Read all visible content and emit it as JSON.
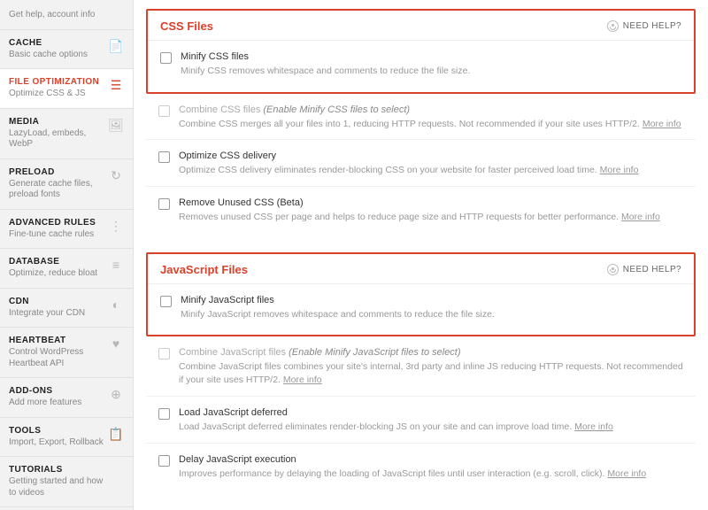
{
  "sidebar": [
    {
      "title": "",
      "sub": "Get help, account info",
      "icon": ""
    },
    {
      "title": "CACHE",
      "sub": "Basic cache options",
      "icon": "📄"
    },
    {
      "title": "FILE OPTIMIZATION",
      "sub": "Optimize CSS & JS",
      "icon": "☰",
      "active": true
    },
    {
      "title": "MEDIA",
      "sub": "LazyLoad, embeds, WebP",
      "icon": "🖼"
    },
    {
      "title": "PRELOAD",
      "sub": "Generate cache files, preload fonts",
      "icon": "↻"
    },
    {
      "title": "ADVANCED RULES",
      "sub": "Fine-tune cache rules",
      "icon": "⋮"
    },
    {
      "title": "DATABASE",
      "sub": "Optimize, reduce bloat",
      "icon": "≡"
    },
    {
      "title": "CDN",
      "sub": "Integrate your CDN",
      "icon": "◐"
    },
    {
      "title": "HEARTBEAT",
      "sub": "Control WordPress Heartbeat API",
      "icon": "♥"
    },
    {
      "title": "ADD-ONS",
      "sub": "Add more features",
      "icon": "⊕"
    },
    {
      "title": "TOOLS",
      "sub": "Import, Export, Rollback",
      "icon": "📋"
    },
    {
      "title": "TUTORIALS",
      "sub": "Getting started and how to videos",
      "icon": ""
    }
  ],
  "help": "NEED HELP?",
  "more": "More info",
  "sections": {
    "css": {
      "title": "CSS Files",
      "options": [
        {
          "title": "Minify CSS files",
          "desc": "Minify CSS removes whitespace and comments to reduce the file size.",
          "boxed": true
        },
        {
          "title": "Combine CSS files",
          "suffix": "(Enable Minify CSS files to select)",
          "desc": "Combine CSS merges all your files into 1, reducing HTTP requests. Not recommended if your site uses HTTP/2.",
          "more": true,
          "disabled": true
        },
        {
          "title": "Optimize CSS delivery",
          "desc": "Optimize CSS delivery eliminates render-blocking CSS on your website for faster perceived load time.",
          "more": true
        },
        {
          "title": "Remove Unused CSS (Beta)",
          "desc": "Removes unused CSS per page and helps to reduce page size and HTTP requests for better performance.",
          "more": true
        }
      ]
    },
    "js": {
      "title": "JavaScript Files",
      "options": [
        {
          "title": "Minify JavaScript files",
          "desc": "Minify JavaScript removes whitespace and comments to reduce the file size.",
          "boxed": true
        },
        {
          "title": "Combine JavaScript files",
          "suffix": "(Enable Minify JavaScript files to select)",
          "desc": "Combine JavaScript files combines your site's internal, 3rd party and inline JS reducing HTTP requests. Not recommended if your site uses HTTP/2.",
          "more": true,
          "disabled": true
        },
        {
          "title": "Load JavaScript deferred",
          "desc": "Load JavaScript deferred eliminates render-blocking JS on your site and can improve load time.",
          "more": true
        },
        {
          "title": "Delay JavaScript execution",
          "desc": "Improves performance by delaying the loading of JavaScript files until user interaction (e.g. scroll, click).",
          "more": true
        }
      ]
    }
  }
}
